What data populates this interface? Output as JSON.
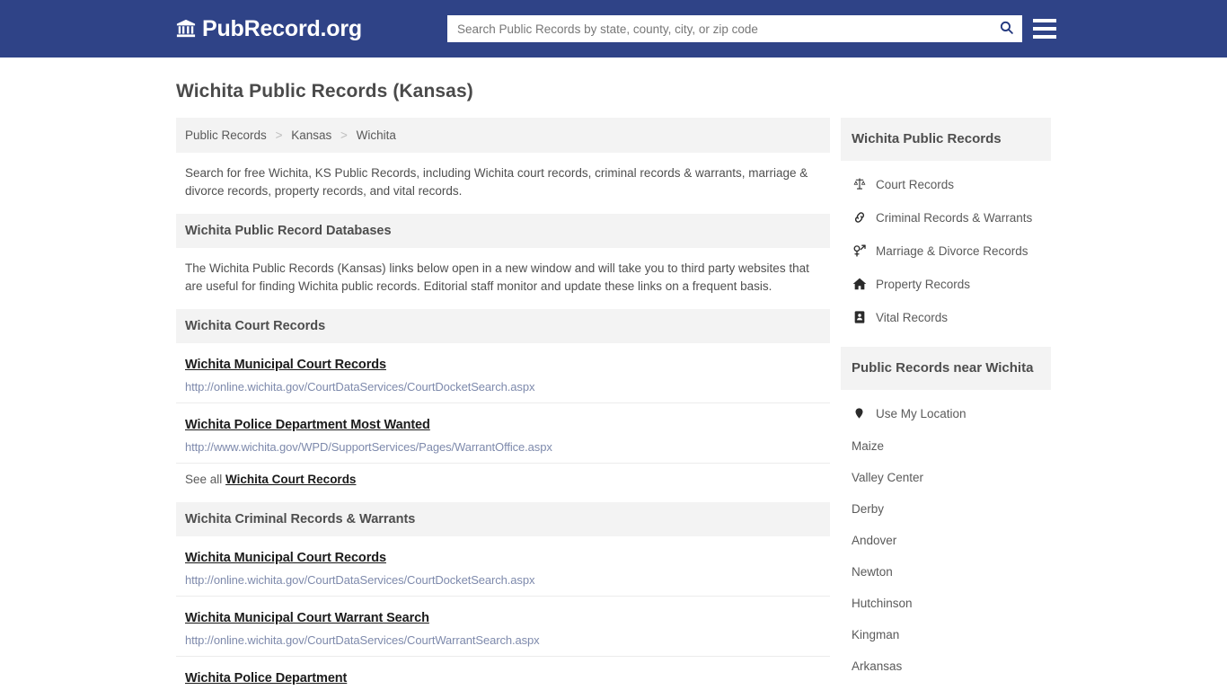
{
  "header": {
    "brand": "PubRecord.org",
    "brand_icon": "bank-icon",
    "search": {
      "placeholder": "Search Public Records by state, county, city, or zip code",
      "value": "",
      "icon": "search-icon"
    },
    "menu_icon": "hamburger-menu-icon",
    "bg_color": "#2f4387"
  },
  "page": {
    "title": "Wichita Public Records (Kansas)",
    "breadcrumb": [
      {
        "label": "Public Records"
      },
      {
        "label": "Kansas"
      },
      {
        "label": "Wichita"
      }
    ],
    "breadcrumb_separator": ">",
    "intro": "Search for free Wichita, KS Public Records, including Wichita court records, criminal records & warrants, marriage & divorce records, property records, and vital records.",
    "databases_heading": "Wichita Public Record Databases",
    "databases_text": "The Wichita Public Records (Kansas) links below open in a new window and will take you to third party websites that are useful for finding Wichita public records. Editorial staff monitor and update these links on a frequent basis.",
    "sections": [
      {
        "heading": "Wichita Court Records",
        "entries": [
          {
            "title": "Wichita Municipal Court Records",
            "url": "http://online.wichita.gov/CourtDataServices/CourtDocketSearch.aspx"
          },
          {
            "title": "Wichita Police Department Most Wanted",
            "url": "http://www.wichita.gov/WPD/SupportServices/Pages/WarrantOffice.aspx"
          }
        ],
        "see_all_prefix": "See all",
        "see_all_link": "Wichita Court Records"
      },
      {
        "heading": "Wichita Criminal Records & Warrants",
        "entries": [
          {
            "title": "Wichita Municipal Court Records",
            "url": "http://online.wichita.gov/CourtDataServices/CourtDocketSearch.aspx"
          },
          {
            "title": "Wichita Municipal Court Warrant Search",
            "url": "http://online.wichita.gov/CourtDataServices/CourtWarrantSearch.aspx"
          },
          {
            "title": "Wichita Police Department",
            "url": ""
          }
        ],
        "see_all_prefix": "",
        "see_all_link": ""
      }
    ]
  },
  "sidebar": {
    "records_heading": "Wichita Public Records",
    "records": [
      {
        "label": "Court Records",
        "icon": "scales-balance-icon"
      },
      {
        "label": "Criminal Records & Warrants",
        "icon": "handcuffs-link-icon"
      },
      {
        "label": "Marriage & Divorce Records",
        "icon": "venus-mars-icon"
      },
      {
        "label": "Property Records",
        "icon": "home-icon"
      },
      {
        "label": "Vital Records",
        "icon": "address-card-icon"
      }
    ],
    "near_heading": "Public Records near Wichita",
    "use_my_location": {
      "label": "Use My Location",
      "icon": "map-marker-icon"
    },
    "nearby_cities": [
      {
        "label": "Maize"
      },
      {
        "label": "Valley Center"
      },
      {
        "label": "Derby"
      },
      {
        "label": "Andover"
      },
      {
        "label": "Newton"
      },
      {
        "label": "Hutchinson"
      },
      {
        "label": "Kingman"
      },
      {
        "label": "Arkansas"
      }
    ]
  }
}
